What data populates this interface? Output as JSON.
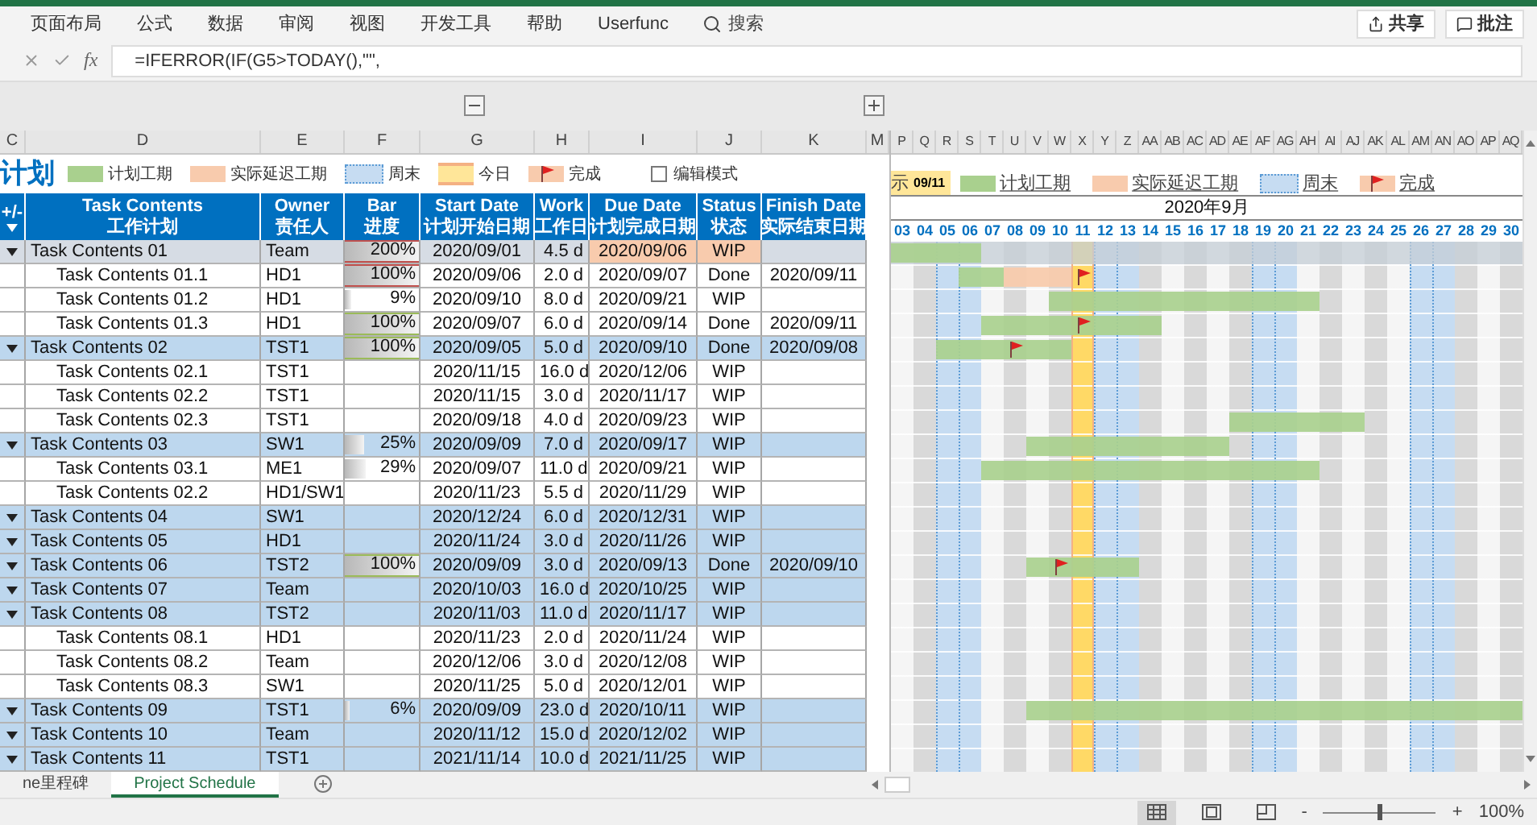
{
  "ribbon": {
    "tabs": [
      "页面布局",
      "公式",
      "数据",
      "审阅",
      "视图",
      "开发工具",
      "帮助",
      "Userfunc"
    ],
    "search": "搜索",
    "actions": [
      {
        "label": "共享",
        "kind": "share"
      },
      {
        "label": "批注",
        "kind": "comment"
      }
    ]
  },
  "formula_bar": {
    "fx": "fx",
    "formula": "=IFERROR(IF(G5>TODAY(),\"\","
  },
  "legend": {
    "title": "计划",
    "items": [
      {
        "label": "计划工期",
        "kind": "plan"
      },
      {
        "label": "实际延迟工期",
        "kind": "delay"
      },
      {
        "label": "周末",
        "kind": "weekend"
      },
      {
        "label": "今日",
        "kind": "today"
      },
      {
        "label": "完成",
        "kind": "done"
      }
    ],
    "edit_mode": {
      "label": "编辑模式",
      "checked": false
    }
  },
  "columns": [
    {
      "letter": "C",
      "title": "+/-"
    },
    {
      "letter": "D",
      "title": "Task Contents",
      "subtitle": "工作计划"
    },
    {
      "letter": "E",
      "title": "Owner",
      "subtitle": "责任人"
    },
    {
      "letter": "F",
      "title": "Bar",
      "subtitle": "进度"
    },
    {
      "letter": "G",
      "title": "Start Date",
      "subtitle": "计划开始日期"
    },
    {
      "letter": "H",
      "title": "Work",
      "subtitle": "工作日"
    },
    {
      "letter": "I",
      "title": "Due Date",
      "subtitle": "计划完成日期"
    },
    {
      "letter": "J",
      "title": "Status",
      "subtitle": "状态"
    },
    {
      "letter": "K",
      "title": "Finish Date",
      "subtitle": "实际结束日期"
    }
  ],
  "spacer_letter": "M",
  "rows": [
    {
      "name": "Task Contents 01",
      "owner": "Team",
      "bar": {
        "text": "200%",
        "level": 1,
        "kind": "late"
      },
      "start": "2020/09/01",
      "work": "4.5 d",
      "due": "2020/09/06",
      "status": "WIP",
      "selected": true,
      "overdue": true,
      "expanded": true,
      "children": [
        {
          "name": "Task Contents 01.1",
          "owner": "HD1",
          "bar": {
            "text": "100%",
            "level": 1,
            "kind": "late"
          },
          "start": "2020/09/06",
          "work": "2.0 d",
          "due": "2020/09/07",
          "status": "Done",
          "finish": "2020/09/11",
          "selected": false,
          "overdue": false
        },
        {
          "name": "Task Contents 01.2",
          "owner": "HD1",
          "bar": {
            "text": "9%",
            "level": 0.09,
            "kind": "plain"
          },
          "start": "2020/09/10",
          "work": "8.0 d",
          "due": "2020/09/21",
          "status": "WIP",
          "selected": false,
          "overdue": false
        },
        {
          "name": "Task Contents 01.3",
          "owner": "HD1",
          "bar": {
            "text": "100%",
            "level": 1,
            "kind": "done"
          },
          "start": "2020/09/07",
          "work": "6.0 d",
          "due": "2020/09/14",
          "status": "Done",
          "finish": "2020/09/11",
          "selected": false,
          "overdue": false
        }
      ]
    },
    {
      "name": "Task Contents 02",
      "owner": "TST1",
      "bar": {
        "text": "100%",
        "level": 1,
        "kind": "done"
      },
      "start": "2020/09/05",
      "work": "5.0 d",
      "due": "2020/09/10",
      "status": "Done",
      "finish": "2020/09/08",
      "selected": false,
      "overdue": false,
      "expanded": true,
      "children": [
        {
          "name": "Task Contents 02.1",
          "owner": "TST1",
          "start": "2020/11/15",
          "work": "16.0 d",
          "due": "2020/12/06",
          "status": "WIP",
          "selected": false,
          "overdue": false
        },
        {
          "name": "Task Contents 02.2",
          "owner": "TST1",
          "start": "2020/11/15",
          "work": "3.0 d",
          "due": "2020/11/17",
          "status": "WIP",
          "selected": false,
          "overdue": false
        },
        {
          "name": "Task Contents 02.3",
          "owner": "TST1",
          "start": "2020/09/18",
          "work": "4.0 d",
          "due": "2020/09/23",
          "status": "WIP",
          "selected": false,
          "overdue": false
        }
      ]
    },
    {
      "name": "Task Contents 03",
      "owner": "SW1",
      "bar": {
        "text": "25%",
        "level": 0.25,
        "kind": "plain"
      },
      "start": "2020/09/09",
      "work": "7.0 d",
      "due": "2020/09/17",
      "status": "WIP",
      "selected": false,
      "overdue": false,
      "expanded": true,
      "children": [
        {
          "name": "Task Contents 03.1",
          "owner": "ME1",
          "bar": {
            "text": "29%",
            "level": 0.29,
            "kind": "plain"
          },
          "start": "2020/09/07",
          "work": "11.0 d",
          "due": "2020/09/21",
          "status": "WIP",
          "selected": false,
          "overdue": false
        },
        {
          "name": "Task Contents 02.2",
          "owner": "HD1/SW1",
          "start": "2020/11/23",
          "work": "5.5 d",
          "due": "2020/11/29",
          "status": "WIP",
          "selected": false,
          "overdue": false
        }
      ]
    },
    {
      "name": "Task Contents 04",
      "owner": "SW1",
      "start": "2020/12/24",
      "work": "6.0 d",
      "due": "2020/12/31",
      "status": "WIP",
      "selected": false,
      "overdue": false,
      "expanded": true
    },
    {
      "name": "Task Contents 05",
      "owner": "HD1",
      "start": "2020/11/24",
      "work": "3.0 d",
      "due": "2020/11/26",
      "status": "WIP",
      "selected": false,
      "overdue": false,
      "expanded": true
    },
    {
      "name": "Task Contents 06",
      "owner": "TST2",
      "bar": {
        "text": "100%",
        "level": 1,
        "kind": "done"
      },
      "start": "2020/09/09",
      "work": "3.0 d",
      "due": "2020/09/13",
      "status": "Done",
      "finish": "2020/09/10",
      "selected": false,
      "overdue": false,
      "expanded": true
    },
    {
      "name": "Task Contents 07",
      "owner": "Team",
      "start": "2020/10/03",
      "work": "16.0 d",
      "due": "2020/10/25",
      "status": "WIP",
      "selected": false,
      "overdue": false,
      "expanded": true
    },
    {
      "name": "Task Contents 08",
      "owner": "TST2",
      "start": "2020/11/03",
      "work": "11.0 d",
      "due": "2020/11/17",
      "status": "WIP",
      "selected": false,
      "overdue": false,
      "expanded": true,
      "children": [
        {
          "name": "Task Contents 08.1",
          "owner": "HD1",
          "start": "2020/11/23",
          "work": "2.0 d",
          "due": "2020/11/24",
          "status": "WIP",
          "selected": false,
          "overdue": false
        },
        {
          "name": "Task Contents 08.2",
          "owner": "Team",
          "start": "2020/12/06",
          "work": "3.0 d",
          "due": "2020/12/08",
          "status": "WIP",
          "selected": false,
          "overdue": false
        },
        {
          "name": "Task Contents 08.3",
          "owner": "SW1",
          "start": "2020/11/25",
          "work": "5.0 d",
          "due": "2020/12/01",
          "status": "WIP",
          "selected": false,
          "overdue": false
        }
      ]
    },
    {
      "name": "Task Contents 09",
      "owner": "TST1",
      "bar": {
        "text": "6%",
        "level": 0.06,
        "kind": "plain"
      },
      "start": "2020/09/09",
      "work": "23.0 d",
      "due": "2020/10/11",
      "status": "WIP",
      "selected": false,
      "overdue": false,
      "expanded": true
    },
    {
      "name": "Task Contents 10",
      "owner": "Team",
      "start": "2020/11/12",
      "work": "15.0 d",
      "due": "2020/12/02",
      "status": "WIP",
      "selected": false,
      "overdue": false,
      "expanded": true
    },
    {
      "name": "Task Contents 11",
      "owner": "TST1",
      "start": "2021/11/14",
      "work": "10.0 d",
      "due": "2021/11/25",
      "status": "WIP",
      "selected": false,
      "overdue": false,
      "expanded": true
    }
  ],
  "gantt": {
    "letters": [
      "P",
      "Q",
      "R",
      "S",
      "T",
      "U",
      "V",
      "W",
      "X",
      "Y",
      "Z",
      "AA",
      "AB",
      "AC",
      "AD",
      "AE",
      "AF",
      "AG",
      "AH",
      "AI",
      "AJ",
      "AK",
      "AL",
      "AM",
      "AN",
      "AO",
      "AP",
      "AQ"
    ],
    "today_label": "示",
    "today": "09/11",
    "legend": [
      {
        "label": "计划工期",
        "kind": "plan"
      },
      {
        "label": "实际延迟工期",
        "kind": "delay"
      },
      {
        "label": "周末",
        "kind": "weekend"
      },
      {
        "label": "完成",
        "kind": "done"
      }
    ],
    "month": "2020年9月",
    "days": [
      {
        "label": "03",
        "kind": "weekday"
      },
      {
        "label": "04",
        "kind": "weekday"
      },
      {
        "label": "05",
        "kind": "weekend"
      },
      {
        "label": "06",
        "kind": "weekend"
      },
      {
        "label": "07",
        "kind": "weekday"
      },
      {
        "label": "08",
        "kind": "weekday"
      },
      {
        "label": "09",
        "kind": "weekday"
      },
      {
        "label": "10",
        "kind": "weekday"
      },
      {
        "label": "11",
        "kind": "today"
      },
      {
        "label": "12",
        "kind": "weekend"
      },
      {
        "label": "13",
        "kind": "weekend"
      },
      {
        "label": "14",
        "kind": "weekday"
      },
      {
        "label": "15",
        "kind": "weekday"
      },
      {
        "label": "16",
        "kind": "weekday"
      },
      {
        "label": "17",
        "kind": "weekday"
      },
      {
        "label": "18",
        "kind": "weekday"
      },
      {
        "label": "19",
        "kind": "weekend"
      },
      {
        "label": "20",
        "kind": "weekend"
      },
      {
        "label": "21",
        "kind": "weekday"
      },
      {
        "label": "22",
        "kind": "weekday"
      },
      {
        "label": "23",
        "kind": "weekday"
      },
      {
        "label": "24",
        "kind": "weekday"
      },
      {
        "label": "25",
        "kind": "weekday"
      },
      {
        "label": "26",
        "kind": "weekend"
      },
      {
        "label": "27",
        "kind": "weekend"
      },
      {
        "label": "28",
        "kind": "weekday"
      },
      {
        "label": "29",
        "kind": "weekday"
      },
      {
        "label": "30",
        "kind": "weekday"
      }
    ]
  },
  "sheet_tabs": [
    {
      "label": "ne里程碑",
      "selected": false
    },
    {
      "label": "Project Schedule",
      "selected": true
    }
  ],
  "status_bar": {
    "views": [
      {
        "kind": "normal",
        "selected": true
      },
      {
        "kind": "page_layout",
        "selected": false
      },
      {
        "kind": "page_break",
        "selected": false
      }
    ],
    "zoom": {
      "minus": "-",
      "plus": "+",
      "level": 0.5,
      "label": "100%"
    }
  }
}
